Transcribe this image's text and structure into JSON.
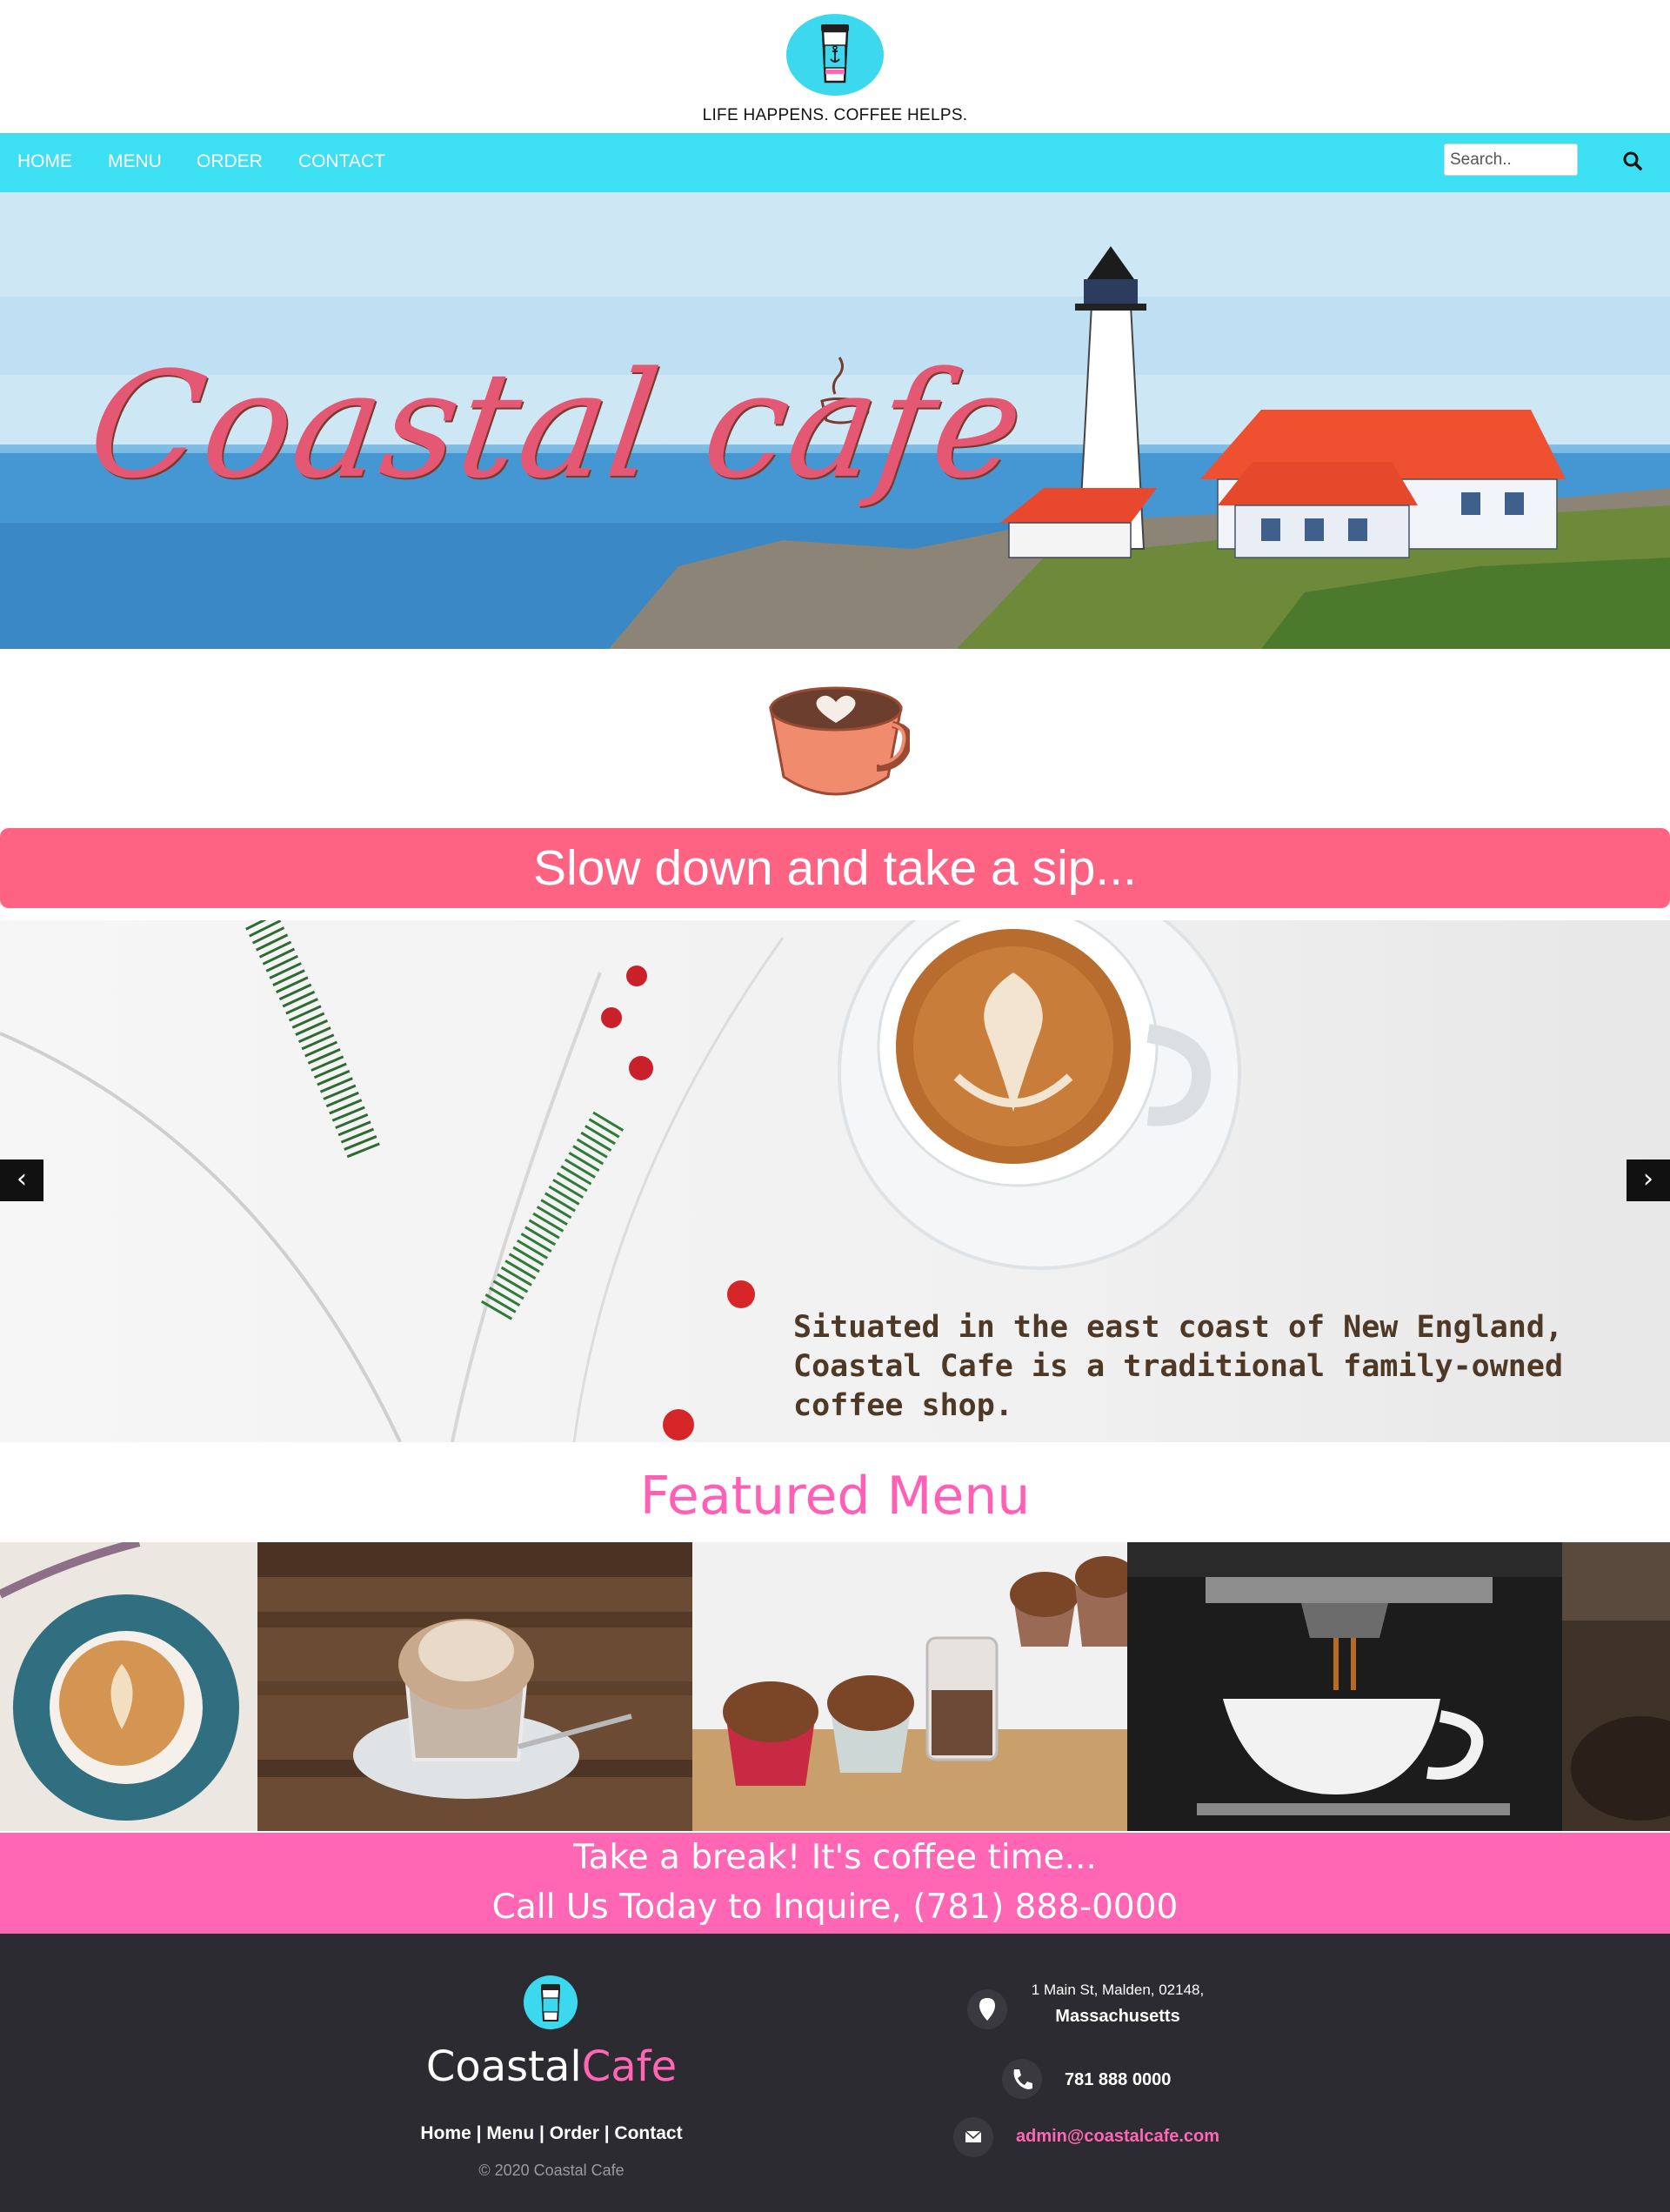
{
  "header": {
    "logo_text": "Coastal Cafe",
    "tagline": "LIFE HAPPENS. COFFEE HELPS."
  },
  "nav": {
    "items": [
      {
        "label": "HOME"
      },
      {
        "label": "MENU"
      },
      {
        "label": "ORDER"
      },
      {
        "label": "CONTACT"
      }
    ],
    "search_placeholder": "Search..",
    "search_icon": "search-icon"
  },
  "hero": {
    "title": "Coastal cafe"
  },
  "sip_banner": {
    "text": "Slow down and take a sip..."
  },
  "carousel": {
    "caption_line1": "Situated in the east coast of New England,",
    "caption_line2": "Coastal Cafe is a traditional family-owned",
    "caption_line3": "coffee shop.",
    "prev": "‹",
    "next": "›"
  },
  "featured": {
    "title": "Featured Menu"
  },
  "break_banner": {
    "line1": "Take a break! It's coffee time...",
    "line2": "Call Us Today to Inquire, (781) 888-0000"
  },
  "footer": {
    "brand_part1": "Coastal",
    "brand_part2": "Cafe",
    "links": [
      {
        "label": "Home"
      },
      {
        "label": "Menu"
      },
      {
        "label": "Order"
      },
      {
        "label": "Contact"
      }
    ],
    "separator": " | ",
    "copyright": "© 2020 Coastal Cafe",
    "address_line1": "1 Main St, Malden, 02148,",
    "address_line2": "Massachusetts",
    "phone": "781 888 0000",
    "email": "admin@coastalcafe.com"
  },
  "colors": {
    "nav_bg": "#3de0f3",
    "sip_banner": "#ff6384",
    "featured_title": "#ff5fb4",
    "break_banner": "#ff66b3",
    "footer_bg": "#2c2b31",
    "email": "#ff66b3"
  }
}
